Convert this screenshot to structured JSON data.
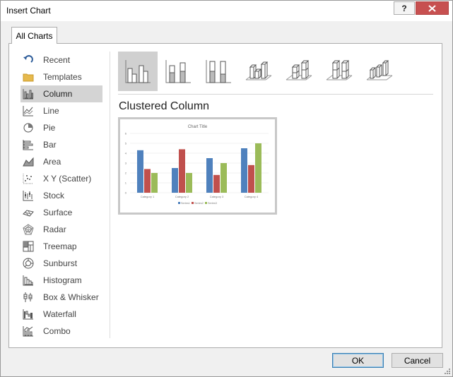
{
  "window": {
    "title": "Insert Chart",
    "help_label": "?"
  },
  "tabs": [
    {
      "label": "All Charts"
    }
  ],
  "sidebar": {
    "items": [
      {
        "label": "Recent",
        "icon": "recent-icon"
      },
      {
        "label": "Templates",
        "icon": "folder-icon"
      },
      {
        "label": "Column",
        "icon": "column-chart-icon",
        "selected": true
      },
      {
        "label": "Line",
        "icon": "line-chart-icon"
      },
      {
        "label": "Pie",
        "icon": "pie-chart-icon"
      },
      {
        "label": "Bar",
        "icon": "bar-chart-icon"
      },
      {
        "label": "Area",
        "icon": "area-chart-icon"
      },
      {
        "label": "X Y (Scatter)",
        "icon": "scatter-chart-icon"
      },
      {
        "label": "Stock",
        "icon": "stock-chart-icon"
      },
      {
        "label": "Surface",
        "icon": "surface-chart-icon"
      },
      {
        "label": "Radar",
        "icon": "radar-chart-icon"
      },
      {
        "label": "Treemap",
        "icon": "treemap-chart-icon"
      },
      {
        "label": "Sunburst",
        "icon": "sunburst-chart-icon"
      },
      {
        "label": "Histogram",
        "icon": "histogram-chart-icon"
      },
      {
        "label": "Box & Whisker",
        "icon": "box-whisker-chart-icon"
      },
      {
        "label": "Waterfall",
        "icon": "waterfall-chart-icon"
      },
      {
        "label": "Combo",
        "icon": "combo-chart-icon"
      }
    ]
  },
  "subtypes": [
    {
      "icon": "clustered-column-icon",
      "selected": true
    },
    {
      "icon": "stacked-column-icon"
    },
    {
      "icon": "100-stacked-column-icon"
    },
    {
      "icon": "3d-clustered-column-icon"
    },
    {
      "icon": "3d-stacked-column-icon"
    },
    {
      "icon": "3d-100-stacked-column-icon"
    },
    {
      "icon": "3d-column-icon"
    }
  ],
  "main": {
    "chart_name": "Clustered Column"
  },
  "preview": {
    "chart_title": "Chart Title",
    "categories": [
      "Category 1",
      "Category 2",
      "Category 3",
      "Category 4"
    ],
    "y_ticks": [
      "0",
      "1",
      "2",
      "3",
      "4",
      "5",
      "6"
    ],
    "series": [
      {
        "name": "Series1",
        "color": "#4f81bd",
        "values": [
          4.3,
          2.5,
          3.5,
          4.5
        ]
      },
      {
        "name": "Series2",
        "color": "#c0504d",
        "values": [
          2.4,
          4.4,
          1.8,
          2.8
        ]
      },
      {
        "name": "Series3",
        "color": "#9bbb59",
        "values": [
          2,
          2,
          3,
          5
        ]
      }
    ],
    "ylim": [
      0,
      6
    ]
  },
  "buttons": {
    "ok": "OK",
    "cancel": "Cancel"
  },
  "colors": {
    "selection": "#d4d4d4",
    "close_button": "#c75050",
    "ok_border": "#3c7fb1"
  }
}
